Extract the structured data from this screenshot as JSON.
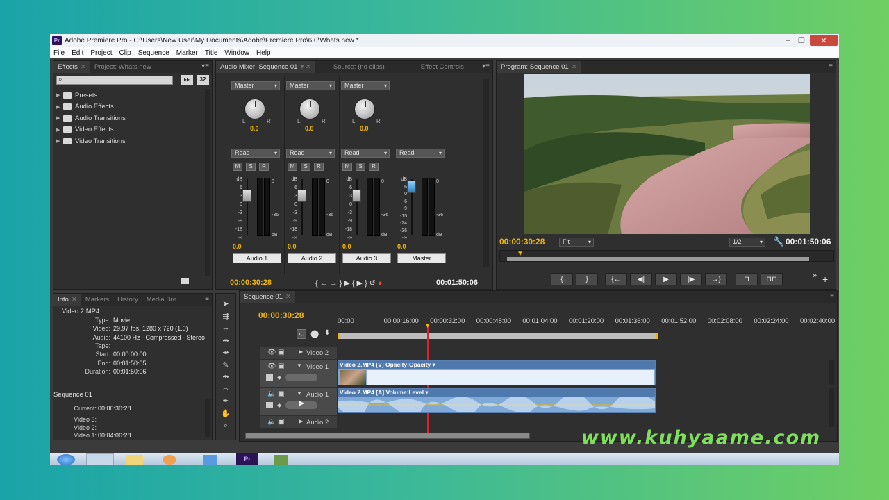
{
  "window": {
    "title": "Adobe Premiere Pro - C:\\Users\\New User\\My Documents\\Adobe\\Premiere Pro\\6.0\\Whats new *",
    "app_icon": "Pr"
  },
  "menu": [
    "File",
    "Edit",
    "Project",
    "Clip",
    "Sequence",
    "Marker",
    "Title",
    "Window",
    "Help"
  ],
  "effects_panel": {
    "tabs": [
      "Effects",
      "Project: Whats new"
    ],
    "folders": [
      "Presets",
      "Audio Effects",
      "Audio Transitions",
      "Video Effects",
      "Video Transitions"
    ],
    "btn1": "32"
  },
  "audio_mixer": {
    "tabs": [
      "Audio Mixer: Sequence 01",
      "Source: (no clips)",
      "Effect Controls"
    ],
    "channels": [
      {
        "output": "Master",
        "pan": "0.0",
        "mode": "Read",
        "level": "0.0",
        "name": "Audio 1"
      },
      {
        "output": "Master",
        "pan": "0.0",
        "mode": "Read",
        "level": "0.0",
        "name": "Audio 2"
      },
      {
        "output": "Master",
        "pan": "0.0",
        "mode": "Read",
        "level": "0.0",
        "name": "Audio 3"
      },
      {
        "mode": "Read",
        "level": "0.0",
        "name": "Master"
      }
    ],
    "msr": [
      "M",
      "S",
      "R"
    ],
    "scale": [
      "dB",
      "6",
      "3",
      "0",
      "-3",
      "-9",
      "-18",
      "-∞"
    ],
    "master_scale": [
      "dB",
      "6",
      "0",
      "-6",
      "-9",
      "-15",
      "-24",
      "-36",
      "-∞"
    ],
    "meter_scale": [
      "0",
      "-36",
      "dB"
    ],
    "time_current": "00:00:30:28",
    "time_duration": "00:01:50:06"
  },
  "program": {
    "tab": "Program: Sequence 01",
    "timecode": "00:00:30:28",
    "fit": "Fit",
    "res": "1/2",
    "duration": "00:01:50:06",
    "playhead_fraction": 0.1
  },
  "info_panel": {
    "tabs": [
      "Info",
      "Markers",
      "History",
      "Media Bro"
    ],
    "clip": "Video 2.MP4",
    "rows": [
      [
        "Type:",
        "Movie"
      ],
      [
        "Video:",
        "29.97 fps, 1280 x 720 (1.0)"
      ],
      [
        "Audio:",
        "44100 Hz - Compressed - Stereo"
      ],
      [
        "Tape:",
        ""
      ],
      [
        "Start:",
        "00:00:00:00"
      ],
      [
        "End:",
        "00:01:50:05"
      ],
      [
        "Duration:",
        "00:01:50:06"
      ]
    ],
    "sequence": "Sequence 01",
    "seq_rows": [
      [
        "Current:",
        "00:00:30:28"
      ],
      [
        "Video 3:",
        ""
      ],
      [
        "Video 2:",
        ""
      ],
      [
        "Video 1:",
        "00:04:06:28"
      ]
    ]
  },
  "timeline": {
    "tab": "Sequence 01",
    "timecode": "00:00:30:28",
    "ruler": [
      "00:00",
      "00:00:16:00",
      "00:00:32:00",
      "00:00:48:00",
      "00:01:04:00",
      "00:01:20:00",
      "00:01:36:00",
      "00:01:52:00",
      "00:02:08:00",
      "00:02:24:00",
      "00:02:40:00"
    ],
    "tracks": [
      "Video 2",
      "Video 1",
      "Audio 1",
      "Audio 2"
    ],
    "video_clip": "Video 2.MP4 [V]  Opacity:Opacity ▾",
    "audio_clip": "Video 2.MP4 [A]  Volume:Level ▾"
  },
  "watermark": "www.kuhyaame.com",
  "colors": {
    "accent_timecode": "#f2b705",
    "bg_left": "#1aa3a8",
    "bg_right": "#6fcf62",
    "clip_blue": "#7fa9d6"
  }
}
